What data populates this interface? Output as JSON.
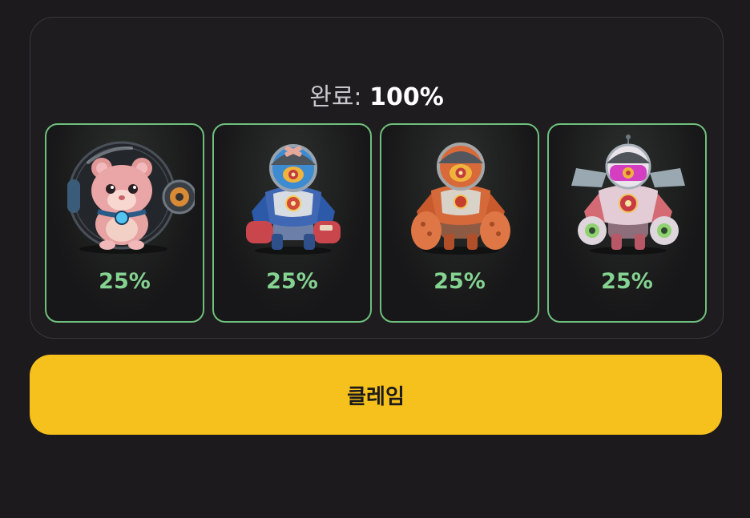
{
  "progress": {
    "label": "완료:",
    "value": "100%"
  },
  "cards": [
    {
      "name": "hamster-ball",
      "percent": "25%"
    },
    {
      "name": "blue-robot",
      "percent": "25%"
    },
    {
      "name": "orange-robot",
      "percent": "25%"
    },
    {
      "name": "pink-robot",
      "percent": "25%"
    }
  ],
  "colors": {
    "card_border": "#6ec07c",
    "percent_text": "#84d391",
    "claim_button": "#f6c11c",
    "background": "#1d1a1e"
  },
  "claim_button": {
    "label": "클레임"
  }
}
